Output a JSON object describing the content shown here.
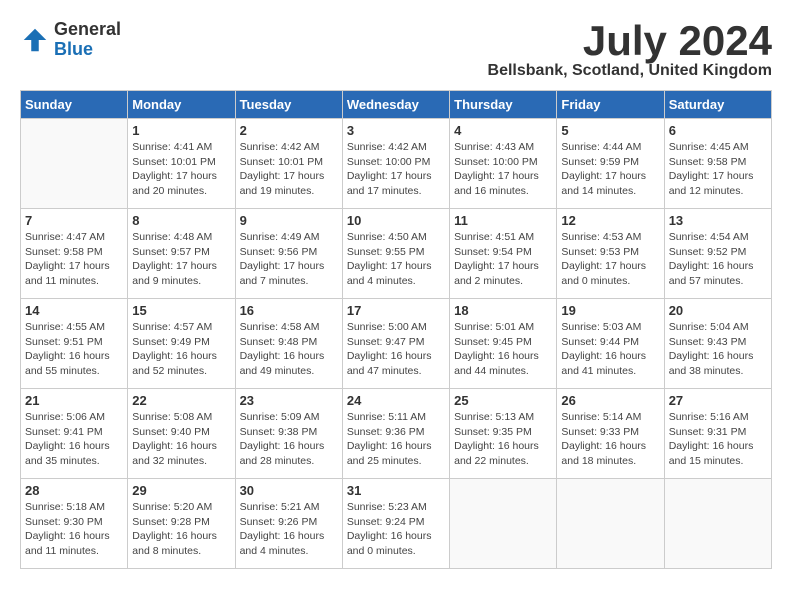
{
  "header": {
    "logo_general": "General",
    "logo_blue": "Blue",
    "title": "July 2024",
    "subtitle": "Bellsbank, Scotland, United Kingdom"
  },
  "calendar": {
    "days_of_week": [
      "Sunday",
      "Monday",
      "Tuesday",
      "Wednesday",
      "Thursday",
      "Friday",
      "Saturday"
    ],
    "weeks": [
      [
        {
          "day": "",
          "info": ""
        },
        {
          "day": "1",
          "info": "Sunrise: 4:41 AM\nSunset: 10:01 PM\nDaylight: 17 hours and 20 minutes."
        },
        {
          "day": "2",
          "info": "Sunrise: 4:42 AM\nSunset: 10:01 PM\nDaylight: 17 hours and 19 minutes."
        },
        {
          "day": "3",
          "info": "Sunrise: 4:42 AM\nSunset: 10:00 PM\nDaylight: 17 hours and 17 minutes."
        },
        {
          "day": "4",
          "info": "Sunrise: 4:43 AM\nSunset: 10:00 PM\nDaylight: 17 hours and 16 minutes."
        },
        {
          "day": "5",
          "info": "Sunrise: 4:44 AM\nSunset: 9:59 PM\nDaylight: 17 hours and 14 minutes."
        },
        {
          "day": "6",
          "info": "Sunrise: 4:45 AM\nSunset: 9:58 PM\nDaylight: 17 hours and 12 minutes."
        }
      ],
      [
        {
          "day": "7",
          "info": "Sunrise: 4:47 AM\nSunset: 9:58 PM\nDaylight: 17 hours and 11 minutes."
        },
        {
          "day": "8",
          "info": "Sunrise: 4:48 AM\nSunset: 9:57 PM\nDaylight: 17 hours and 9 minutes."
        },
        {
          "day": "9",
          "info": "Sunrise: 4:49 AM\nSunset: 9:56 PM\nDaylight: 17 hours and 7 minutes."
        },
        {
          "day": "10",
          "info": "Sunrise: 4:50 AM\nSunset: 9:55 PM\nDaylight: 17 hours and 4 minutes."
        },
        {
          "day": "11",
          "info": "Sunrise: 4:51 AM\nSunset: 9:54 PM\nDaylight: 17 hours and 2 minutes."
        },
        {
          "day": "12",
          "info": "Sunrise: 4:53 AM\nSunset: 9:53 PM\nDaylight: 17 hours and 0 minutes."
        },
        {
          "day": "13",
          "info": "Sunrise: 4:54 AM\nSunset: 9:52 PM\nDaylight: 16 hours and 57 minutes."
        }
      ],
      [
        {
          "day": "14",
          "info": "Sunrise: 4:55 AM\nSunset: 9:51 PM\nDaylight: 16 hours and 55 minutes."
        },
        {
          "day": "15",
          "info": "Sunrise: 4:57 AM\nSunset: 9:49 PM\nDaylight: 16 hours and 52 minutes."
        },
        {
          "day": "16",
          "info": "Sunrise: 4:58 AM\nSunset: 9:48 PM\nDaylight: 16 hours and 49 minutes."
        },
        {
          "day": "17",
          "info": "Sunrise: 5:00 AM\nSunset: 9:47 PM\nDaylight: 16 hours and 47 minutes."
        },
        {
          "day": "18",
          "info": "Sunrise: 5:01 AM\nSunset: 9:45 PM\nDaylight: 16 hours and 44 minutes."
        },
        {
          "day": "19",
          "info": "Sunrise: 5:03 AM\nSunset: 9:44 PM\nDaylight: 16 hours and 41 minutes."
        },
        {
          "day": "20",
          "info": "Sunrise: 5:04 AM\nSunset: 9:43 PM\nDaylight: 16 hours and 38 minutes."
        }
      ],
      [
        {
          "day": "21",
          "info": "Sunrise: 5:06 AM\nSunset: 9:41 PM\nDaylight: 16 hours and 35 minutes."
        },
        {
          "day": "22",
          "info": "Sunrise: 5:08 AM\nSunset: 9:40 PM\nDaylight: 16 hours and 32 minutes."
        },
        {
          "day": "23",
          "info": "Sunrise: 5:09 AM\nSunset: 9:38 PM\nDaylight: 16 hours and 28 minutes."
        },
        {
          "day": "24",
          "info": "Sunrise: 5:11 AM\nSunset: 9:36 PM\nDaylight: 16 hours and 25 minutes."
        },
        {
          "day": "25",
          "info": "Sunrise: 5:13 AM\nSunset: 9:35 PM\nDaylight: 16 hours and 22 minutes."
        },
        {
          "day": "26",
          "info": "Sunrise: 5:14 AM\nSunset: 9:33 PM\nDaylight: 16 hours and 18 minutes."
        },
        {
          "day": "27",
          "info": "Sunrise: 5:16 AM\nSunset: 9:31 PM\nDaylight: 16 hours and 15 minutes."
        }
      ],
      [
        {
          "day": "28",
          "info": "Sunrise: 5:18 AM\nSunset: 9:30 PM\nDaylight: 16 hours and 11 minutes."
        },
        {
          "day": "29",
          "info": "Sunrise: 5:20 AM\nSunset: 9:28 PM\nDaylight: 16 hours and 8 minutes."
        },
        {
          "day": "30",
          "info": "Sunrise: 5:21 AM\nSunset: 9:26 PM\nDaylight: 16 hours and 4 minutes."
        },
        {
          "day": "31",
          "info": "Sunrise: 5:23 AM\nSunset: 9:24 PM\nDaylight: 16 hours and 0 minutes."
        },
        {
          "day": "",
          "info": ""
        },
        {
          "day": "",
          "info": ""
        },
        {
          "day": "",
          "info": ""
        }
      ]
    ]
  }
}
